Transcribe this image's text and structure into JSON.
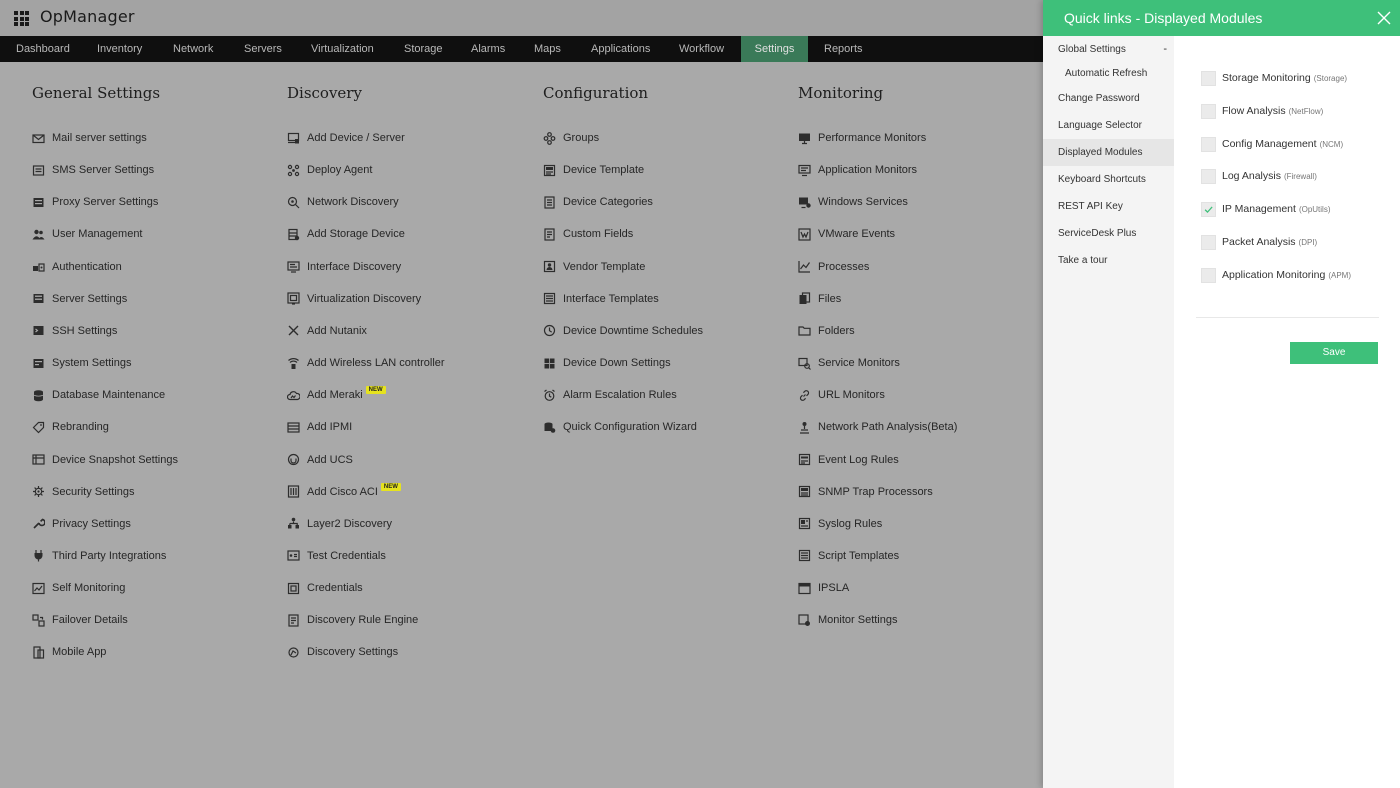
{
  "app": {
    "brand": "OpManager"
  },
  "nav": [
    {
      "label": "Dashboard",
      "active": false
    },
    {
      "label": "Inventory",
      "active": false
    },
    {
      "label": "Network",
      "active": false
    },
    {
      "label": "Servers",
      "active": false
    },
    {
      "label": "Virtualization",
      "active": false
    },
    {
      "label": "Storage",
      "active": false
    },
    {
      "label": "Alarms",
      "active": false
    },
    {
      "label": "Maps",
      "active": false
    },
    {
      "label": "Applications",
      "active": false
    },
    {
      "label": "Workflow",
      "active": false
    },
    {
      "label": "Settings",
      "active": true
    },
    {
      "label": "Reports",
      "active": false
    }
  ],
  "columns": [
    {
      "title": "General Settings",
      "items": [
        {
          "label": "Mail server settings",
          "icon": "mail-icon"
        },
        {
          "label": "SMS Server Settings",
          "icon": "sms-icon"
        },
        {
          "label": "Proxy Server Settings",
          "icon": "proxy-icon"
        },
        {
          "label": "User Management",
          "icon": "users-icon"
        },
        {
          "label": "Authentication",
          "icon": "auth-icon"
        },
        {
          "label": "Server Settings",
          "icon": "server-icon"
        },
        {
          "label": "SSH Settings",
          "icon": "ssh-icon"
        },
        {
          "label": "System Settings",
          "icon": "system-icon"
        },
        {
          "label": "Database Maintenance",
          "icon": "database-icon"
        },
        {
          "label": "Rebranding",
          "icon": "tag-icon"
        },
        {
          "label": "Device Snapshot Settings",
          "icon": "snapshot-icon"
        },
        {
          "label": "Security Settings",
          "icon": "security-icon"
        },
        {
          "label": "Privacy Settings",
          "icon": "wrench-icon"
        },
        {
          "label": "Third Party Integrations",
          "icon": "plug-icon"
        },
        {
          "label": "Self Monitoring",
          "icon": "chart-icon"
        },
        {
          "label": "Failover Details",
          "icon": "failover-icon"
        },
        {
          "label": "Mobile App",
          "icon": "mobile-icon"
        }
      ]
    },
    {
      "title": "Discovery",
      "items": [
        {
          "label": "Add Device / Server",
          "icon": "add-device-icon"
        },
        {
          "label": "Deploy Agent",
          "icon": "agent-icon"
        },
        {
          "label": "Network Discovery",
          "icon": "network-discovery-icon"
        },
        {
          "label": "Add Storage Device",
          "icon": "storage-icon"
        },
        {
          "label": "Interface Discovery",
          "icon": "interface-icon"
        },
        {
          "label": "Virtualization Discovery",
          "icon": "virtualization-icon"
        },
        {
          "label": "Add Nutanix",
          "icon": "nutanix-icon"
        },
        {
          "label": "Add Wireless LAN controller",
          "icon": "wireless-icon"
        },
        {
          "label": "Add Meraki",
          "icon": "cloud-icon",
          "badge": "NEW"
        },
        {
          "label": "Add IPMI",
          "icon": "ipmi-icon"
        },
        {
          "label": "Add UCS",
          "icon": "ucs-icon"
        },
        {
          "label": "Add Cisco ACI",
          "icon": "aci-icon",
          "badge": "NEW"
        },
        {
          "label": "Layer2 Discovery",
          "icon": "layer2-icon"
        },
        {
          "label": "Test Credentials",
          "icon": "test-credentials-icon"
        },
        {
          "label": "Credentials",
          "icon": "credentials-icon"
        },
        {
          "label": "Discovery Rule Engine",
          "icon": "rule-engine-icon"
        },
        {
          "label": "Discovery Settings",
          "icon": "discovery-settings-icon"
        }
      ]
    },
    {
      "title": "Configuration",
      "items": [
        {
          "label": "Groups",
          "icon": "groups-icon"
        },
        {
          "label": "Device Template",
          "icon": "template-icon"
        },
        {
          "label": "Device Categories",
          "icon": "categories-icon"
        },
        {
          "label": "Custom Fields",
          "icon": "custom-fields-icon"
        },
        {
          "label": "Vendor Template",
          "icon": "vendor-icon"
        },
        {
          "label": "Interface Templates",
          "icon": "interface-template-icon"
        },
        {
          "label": "Device Downtime Schedules",
          "icon": "clock-icon"
        },
        {
          "label": "Device Down Settings",
          "icon": "device-down-icon"
        },
        {
          "label": "Alarm Escalation Rules",
          "icon": "alarm-icon"
        },
        {
          "label": "Quick Configuration Wizard",
          "icon": "wizard-icon"
        }
      ]
    },
    {
      "title": "Monitoring",
      "items": [
        {
          "label": "Performance Monitors",
          "icon": "monitor-icon"
        },
        {
          "label": "Application Monitors",
          "icon": "app-monitor-icon"
        },
        {
          "label": "Windows Services",
          "icon": "windows-icon"
        },
        {
          "label": "VMware Events",
          "icon": "vmware-icon"
        },
        {
          "label": "Processes",
          "icon": "processes-icon"
        },
        {
          "label": "Files",
          "icon": "files-icon"
        },
        {
          "label": "Folders",
          "icon": "folder-icon"
        },
        {
          "label": "Service Monitors",
          "icon": "service-icon"
        },
        {
          "label": "URL Monitors",
          "icon": "link-icon"
        },
        {
          "label": "Network Path Analysis(Beta)",
          "icon": "path-icon"
        },
        {
          "label": "Event Log Rules",
          "icon": "event-log-icon"
        },
        {
          "label": "SNMP Trap Processors",
          "icon": "snmp-icon"
        },
        {
          "label": "Syslog Rules",
          "icon": "syslog-icon"
        },
        {
          "label": "Script Templates",
          "icon": "script-icon"
        },
        {
          "label": "IPSLA",
          "icon": "ipsla-icon"
        },
        {
          "label": "Monitor Settings",
          "icon": "monitor-settings-icon"
        }
      ]
    }
  ],
  "panel": {
    "title": "Quick links - Displayed Modules",
    "menu": [
      {
        "label": "Global Settings",
        "toggle": "-"
      },
      {
        "label": "Automatic Refresh",
        "sub": true
      },
      {
        "label": "Change Password"
      },
      {
        "label": "Language Selector"
      },
      {
        "label": "Displayed Modules",
        "active": true
      },
      {
        "label": "Keyboard Shortcuts"
      },
      {
        "label": "REST API Key"
      },
      {
        "label": "ServiceDesk Plus"
      },
      {
        "label": "Take a tour"
      }
    ],
    "modules": [
      {
        "label": "Storage Monitoring",
        "tag": "(Storage)",
        "checked": false
      },
      {
        "label": "Flow Analysis",
        "tag": "(NetFlow)",
        "checked": false
      },
      {
        "label": "Config Management",
        "tag": "(NCM)",
        "checked": false
      },
      {
        "label": "Log Analysis",
        "tag": "(Firewall)",
        "checked": false
      },
      {
        "label": "IP Management",
        "tag": "(OpUtils)",
        "checked": true
      },
      {
        "label": "Packet Analysis",
        "tag": "(DPI)",
        "checked": false
      },
      {
        "label": "Application Monitoring",
        "tag": "(APM)",
        "checked": false
      }
    ],
    "save_label": "Save"
  },
  "colors": {
    "accent": "#3ec07a",
    "nav_active": "#3a7a58",
    "navbar": "#0f0f0f",
    "overlay": "#a9a9a9"
  }
}
